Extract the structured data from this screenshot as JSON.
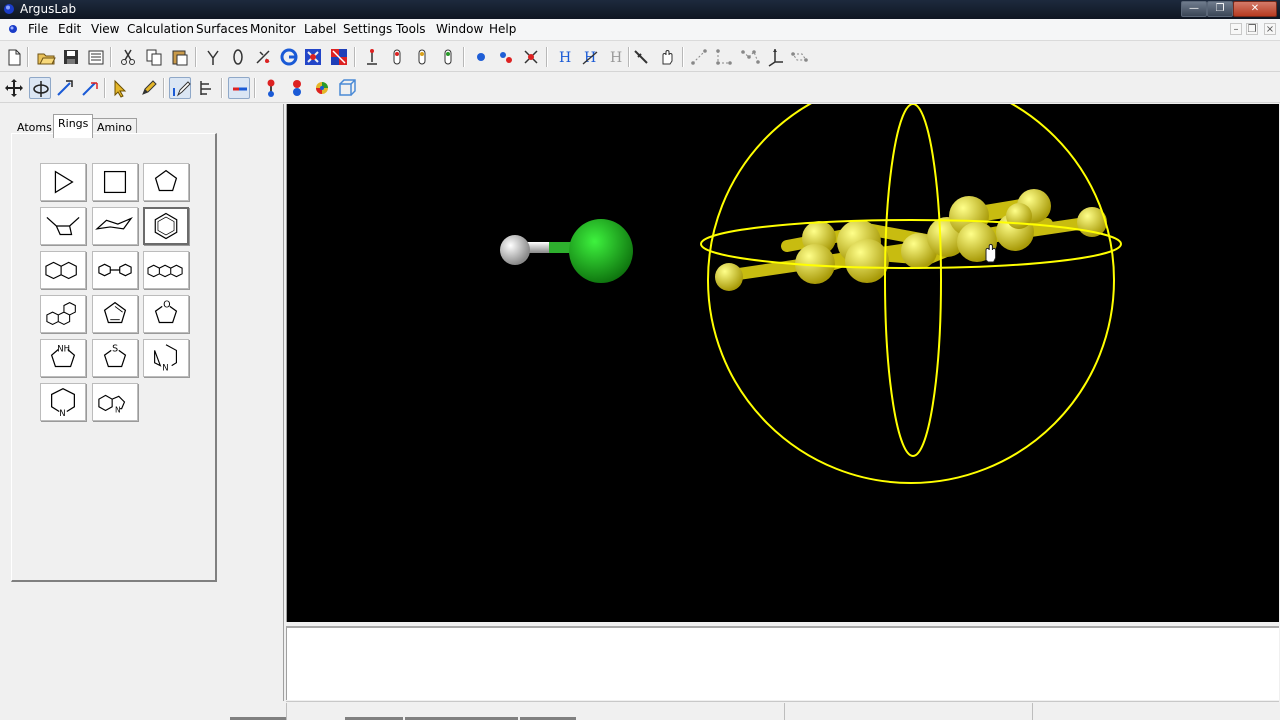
{
  "window": {
    "title": "ArgusLab",
    "controls": [
      "minimize-icon",
      "restore-icon",
      "close-icon"
    ]
  },
  "menubar": {
    "items": [
      "File",
      "Edit",
      "View",
      "Calculation",
      "Surfaces",
      "Monitor",
      "Label",
      "Settings",
      "Tools",
      "Window",
      "Help"
    ],
    "mdi_controls": [
      "minimize-icon",
      "restore-icon",
      "close-icon"
    ]
  },
  "toolbar_main": {
    "icons": [
      "new-icon",
      "open-icon",
      "save-icon",
      "print-icon",
      "cut-icon",
      "copy-icon",
      "paste-icon",
      "branch-icon",
      "ring-icon",
      "add-bond-icon",
      "builder-icon",
      "geometry-icon",
      "checkerboard-icon",
      "single-bond-icon",
      "double-bond-icon",
      "triple-bond-icon",
      "aromatic-bond-icon",
      "atom-icon",
      "molecule-icon",
      "delete-icon",
      "hydrogen-icon",
      "add-hydrogen-icon",
      "remove-hydrogen-icon",
      "measure-icon",
      "hand-icon",
      "distance-icon",
      "angle-icon",
      "dihedral-icon",
      "axes-icon",
      "rotate-bond-icon"
    ]
  },
  "toolbar_view": {
    "icons": [
      "translate-icon",
      "rotate-icon",
      "rotate-z-icon",
      "zoom-icon",
      "select-icon",
      "pencil-icon",
      "stick-pencil-icon",
      "fragment-icon",
      "bond-icon",
      "ball-stick-icon",
      "cpk-icon",
      "color-sphere-icon",
      "box-icon"
    ]
  },
  "palette": {
    "tabs": [
      "Atoms",
      "Rings",
      "Amino Acids"
    ],
    "selected_tab": "Rings",
    "rings": [
      {
        "name": "cyclopropane",
        "label": ""
      },
      {
        "name": "cyclobutane",
        "label": ""
      },
      {
        "name": "cyclopentane",
        "label": ""
      },
      {
        "name": "cyclohexane-boat",
        "label": ""
      },
      {
        "name": "cyclohexane-chair",
        "label": ""
      },
      {
        "name": "benzene",
        "label": ""
      },
      {
        "name": "naphthalene",
        "label": ""
      },
      {
        "name": "biphenyl",
        "label": ""
      },
      {
        "name": "anthracene",
        "label": ""
      },
      {
        "name": "phenanthrene",
        "label": ""
      },
      {
        "name": "cyclopentadiene",
        "label": ""
      },
      {
        "name": "furan",
        "label": "O"
      },
      {
        "name": "pyrrole",
        "label": "NH"
      },
      {
        "name": "thiophene",
        "label": "S"
      },
      {
        "name": "pyrimidine",
        "label": "N"
      },
      {
        "name": "pyridine",
        "label": "N"
      },
      {
        "name": "indole",
        "label": "N"
      }
    ],
    "selected_ring": "benzene"
  },
  "viewport": {
    "background": "#000000",
    "molecules": [
      {
        "name": "hydrogen-chloride",
        "atoms": [
          "H",
          "Cl"
        ]
      },
      {
        "name": "selected-aromatic",
        "selected": true
      }
    ],
    "colors": {
      "hydrogen": "#ffffff",
      "chlorine": "#2ecc2e",
      "selection": "#ffff00",
      "selected_atom": "#e8d82a"
    }
  },
  "output": {
    "text": ""
  },
  "statusbar": {
    "cells": [
      "",
      "",
      "",
      ""
    ]
  }
}
